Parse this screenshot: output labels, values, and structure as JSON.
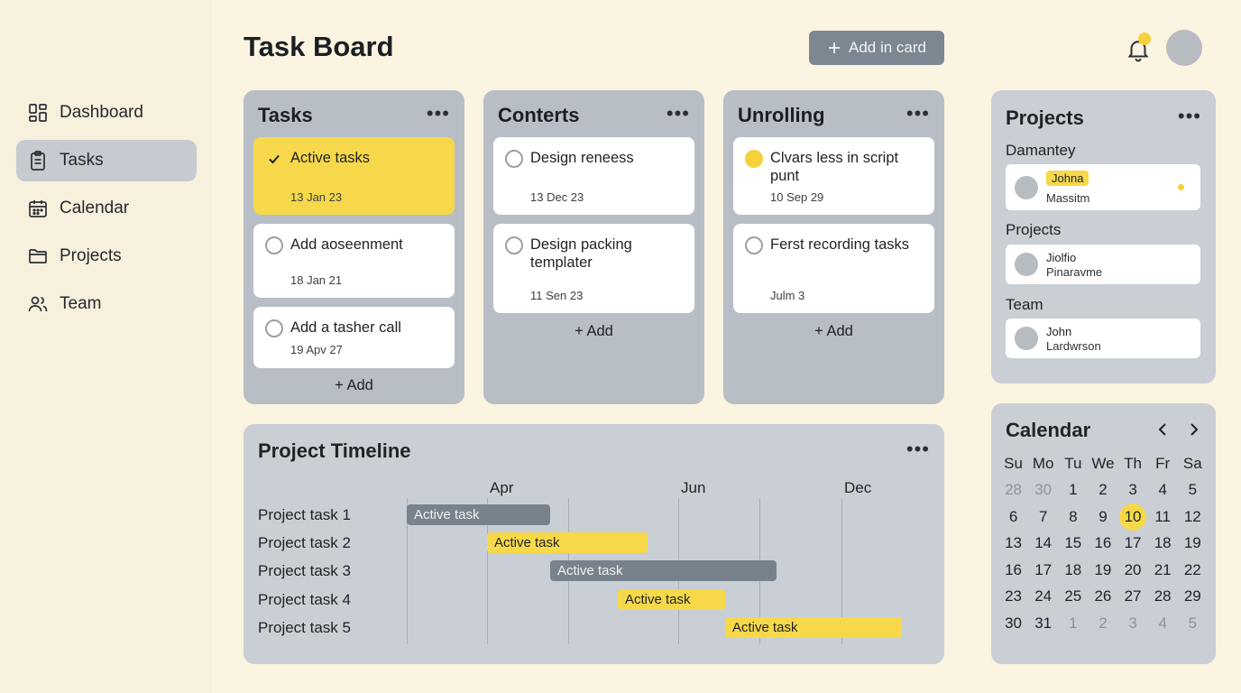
{
  "sidebar": {
    "items": [
      {
        "label": "Dashboard",
        "icon": "dashboard-icon"
      },
      {
        "label": "Tasks",
        "icon": "clipboard-icon",
        "active": true
      },
      {
        "label": "Calendar",
        "icon": "calendar-icon"
      },
      {
        "label": "Projects",
        "icon": "folder-icon"
      },
      {
        "label": "Team",
        "icon": "team-icon"
      }
    ]
  },
  "header": {
    "title": "Task Board",
    "add_card_label": "Add in card"
  },
  "columns": [
    {
      "title": "Tasks",
      "cards": [
        {
          "title": "Active tasks",
          "date": "13 Jan 23"
        },
        {
          "title": "Add aoseenment",
          "date": "18 Jan 21"
        },
        {
          "title": "Add a tasher call",
          "date": "19 Apv 27"
        }
      ],
      "add_label": "+ Add"
    },
    {
      "title": "Conterts",
      "cards": [
        {
          "title": "Design reneess",
          "date": "13 Dec 23"
        },
        {
          "title": "Design packing templater",
          "date": "11 Sen 23"
        }
      ],
      "add_label": "+ Add"
    },
    {
      "title": "Unrolling",
      "cards": [
        {
          "title": "Clvars less in script punt",
          "date": "10 Sep 29"
        },
        {
          "title": "Ferst recording tasks",
          "date": "Julm 3"
        }
      ],
      "add_label": "+ Add"
    }
  ],
  "timeline": {
    "title": "Project Timeline",
    "months": [
      "Apr",
      "Jun",
      "Dec"
    ],
    "rows": [
      {
        "label": "Project task 1",
        "bar_label": "Active task",
        "color": "gray"
      },
      {
        "label": "Project task 2",
        "bar_label": "Active task",
        "color": "yellow"
      },
      {
        "label": "Project task 3",
        "bar_label": "Active task",
        "color": "gray"
      },
      {
        "label": "Project task 4",
        "bar_label": "Active task",
        "color": "yellow"
      },
      {
        "label": "Project task 5",
        "bar_label": "Active task",
        "color": "yellow"
      }
    ]
  },
  "projects_panel": {
    "title": "Projects",
    "sections": [
      {
        "heading": "Damantey",
        "name": "Johna",
        "sub": "Massitm"
      },
      {
        "heading": "Projects",
        "name": "Jiolfio",
        "sub": "Pinaravme"
      },
      {
        "heading": "Team",
        "name": "John",
        "sub": "Lardwrson"
      }
    ]
  },
  "calendar": {
    "title": "Calendar",
    "weekdays": [
      "Su",
      "Mo",
      "Tu",
      "We",
      "Th",
      "Fr",
      "Sa"
    ],
    "days": [
      [
        "28",
        "30",
        "1",
        "2",
        "3",
        "4",
        "5"
      ],
      [
        "6",
        "7",
        "8",
        "9",
        "10",
        "11",
        "12"
      ],
      [
        "13",
        "14",
        "15",
        "16",
        "17",
        "18",
        "19"
      ],
      [
        "16",
        "17",
        "18",
        "19",
        "20",
        "21",
        "22"
      ],
      [
        "23",
        "24",
        "25",
        "26",
        "27",
        "28",
        "29"
      ],
      [
        "30",
        "31",
        "1",
        "2",
        "3",
        "4",
        "5"
      ]
    ],
    "today": "10"
  },
  "colors": {
    "accent_yellow": "#f6d84a",
    "panel_gray": "#c9cfd5",
    "column_gray": "#b8bec5",
    "bar_gray": "#77828c",
    "background": "#faf4e0"
  }
}
